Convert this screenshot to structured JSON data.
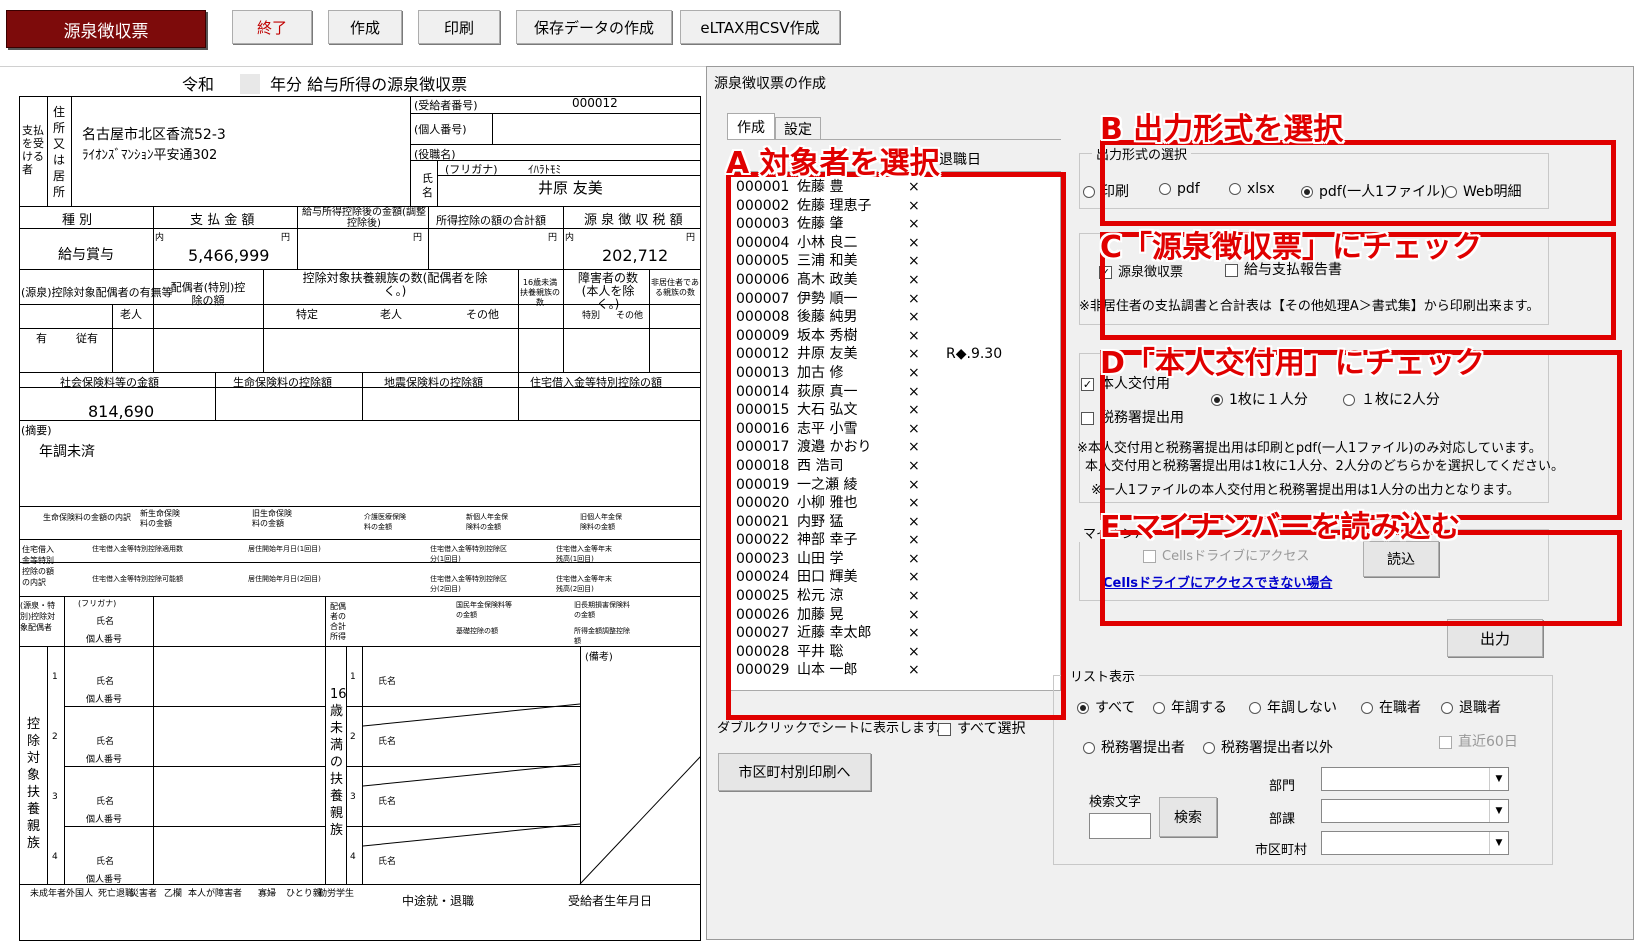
{
  "toolbar": {
    "brand": "源泉徴収票",
    "buttons": [
      "終了",
      "作成",
      "印刷",
      "保存データの作成",
      "eLTAX用CSV作成"
    ]
  },
  "form": {
    "title_prefix": "令和",
    "title_suffix": "年分 給与所得の源泉徴収票",
    "payee_label": "支払を受ける者",
    "address_label": "住所又は居所",
    "address_line1": "名古屋市北区香流52-3",
    "address_line2": "ﾗｲｵﾝｽﾞﾏﾝｼｮﾝ平安通302",
    "recipient_no_label": "(受給者番号)",
    "recipient_no": "000012",
    "personal_no_label": "(個人番号)",
    "position_label": "(役職名)",
    "name_label": "氏名",
    "furigana_label": "(フリガナ)",
    "furigana": "ｲﾊﾗﾄﾓﾐ",
    "name": "井原 友美",
    "col_type": "種 別",
    "col_payment": "支 払 金 額",
    "col_after_deduction": "給与所得控除後の金額(調整控除後)",
    "col_deduction_total": "所得控除の額の合計額",
    "col_withholding": "源 泉 徴 収 税 額",
    "row_type_value": "給与賞与",
    "payment_amount": "5,466,999",
    "withholding_amount": "202,712",
    "unit_yen": "円",
    "inner_label": "内",
    "spouse_label": "(源泉)控除対象配偶者の有無等",
    "elderly_label": "老人",
    "has_label": "有",
    "dependent_label": "従有",
    "spouse_deduction_label": "配偶者(特別)控除の額",
    "dependents_count_label": "控除対象扶養親族の数(配偶者を除く。)",
    "specific_label": "特定",
    "other_label": "その他",
    "under16_label": "16歳未満扶養親族の数",
    "disabled_label": "障害者の数(本人を除く。)",
    "special_label": "特別",
    "nonresident_label": "非居住者である親族の数",
    "person_unit": "人",
    "dependent_unit": "従人",
    "social_insurance_label": "社会保険料等の金額",
    "life_insurance_label": "生命保険料の控除額",
    "earthquake_label": "地震保険料の控除額",
    "housing_loan_label": "住宅借入金等特別控除の額",
    "social_insurance_amount": "814,690",
    "remarks_label": "(摘要)",
    "remarks_value": "年調未済",
    "life_detail_label": "生命保険料の金額の内訳",
    "new_life_label": "新生命保険料の金額",
    "old_life_label": "旧生命保険料の金額",
    "care_label": "介護医療保険料の金額",
    "new_pension_label": "新個人年金保険料の金額",
    "old_pension_label": "旧個人年金保険料の金額",
    "housing_detail_label": "住宅借入金等特別控除の額の内訳",
    "housing_count_label": "住宅借入金等特別控除適用数",
    "residence_date_label": "居住開始年月日(1回目)",
    "residence_date2_label": "居住開始年月日(2回目)",
    "housing_type_label": "住宅借入金等特別控除区分(1回目)",
    "housing_type2_label": "住宅借入金等特別控除区分(2回目)",
    "balance_label": "住宅借入金等年末残高(1回目)",
    "balance2_label": "住宅借入金等年末残高(2回目)",
    "possible_label": "住宅借入金等特別控除可能額",
    "spouse_section_label": "(源泉・特別)控除対象配偶者",
    "furigana_short": "(フリガナ)",
    "name_short": "氏名",
    "personal_no_short": "個人番号",
    "category_label": "区分",
    "spouse_income_label": "配偶者の合計所得",
    "national_pension_label": "国民年金保険料等の金額",
    "old_longterm_label": "旧長期損害保険料の金額",
    "basic_deduction_label": "基礎控除の額",
    "adjust_label": "所得金額調整控除額",
    "dependents_section_label": "控除対象扶養親族",
    "under16_section_label": "16歳未満の扶養親族",
    "remarks2_label": "(備考)",
    "nums": [
      "1",
      "2",
      "3",
      "4"
    ],
    "footer_labels": [
      "未成年者",
      "外国人",
      "死亡退職",
      "災害者",
      "乙欄",
      "本人が障害者",
      "寡婦",
      "ひとり親",
      "勤労学生"
    ],
    "footer_disabled_sub": [
      "特別",
      "その他"
    ],
    "footer_midway": "中途就・退職",
    "footer_birth": "受給者生年月日"
  },
  "dialog": {
    "title": "源泉徴収票の作成",
    "tabs": [
      "作成",
      "設定"
    ],
    "list_header_retire": "退職日",
    "employees": [
      {
        "code": "000001",
        "name": "佐藤 豊",
        "mark": "×",
        "retire": ""
      },
      {
        "code": "000002",
        "name": "佐藤 理恵子",
        "mark": "×",
        "retire": ""
      },
      {
        "code": "000003",
        "name": "佐藤 肇",
        "mark": "×",
        "retire": ""
      },
      {
        "code": "000004",
        "name": "小林 良二",
        "mark": "×",
        "retire": ""
      },
      {
        "code": "000005",
        "name": "三浦 和美",
        "mark": "×",
        "retire": ""
      },
      {
        "code": "000006",
        "name": "髙木 政美",
        "mark": "×",
        "retire": ""
      },
      {
        "code": "000007",
        "name": "伊勢 順一",
        "mark": "×",
        "retire": ""
      },
      {
        "code": "000008",
        "name": "後藤 純男",
        "mark": "×",
        "retire": ""
      },
      {
        "code": "000009",
        "name": "坂本 秀樹",
        "mark": "×",
        "retire": ""
      },
      {
        "code": "000012",
        "name": "井原 友美",
        "mark": "×",
        "retire": "R◆.9.30"
      },
      {
        "code": "000013",
        "name": "加古 修",
        "mark": "×",
        "retire": ""
      },
      {
        "code": "000014",
        "name": "荻原 真一",
        "mark": "×",
        "retire": ""
      },
      {
        "code": "000015",
        "name": "大石 弘文",
        "mark": "×",
        "retire": ""
      },
      {
        "code": "000016",
        "name": "志平 小雪",
        "mark": "×",
        "retire": ""
      },
      {
        "code": "000017",
        "name": "渡邉 かおり",
        "mark": "×",
        "retire": ""
      },
      {
        "code": "000018",
        "name": "西 浩司",
        "mark": "×",
        "retire": ""
      },
      {
        "code": "000019",
        "name": "一之瀬 綾",
        "mark": "×",
        "retire": ""
      },
      {
        "code": "000020",
        "name": "小柳 雅也",
        "mark": "×",
        "retire": ""
      },
      {
        "code": "000021",
        "name": "内野 猛",
        "mark": "×",
        "retire": ""
      },
      {
        "code": "000022",
        "name": "神部 幸子",
        "mark": "×",
        "retire": ""
      },
      {
        "code": "000023",
        "name": "山田 学",
        "mark": "×",
        "retire": ""
      },
      {
        "code": "000024",
        "name": "田口 輝美",
        "mark": "×",
        "retire": ""
      },
      {
        "code": "000025",
        "name": "松元 涼",
        "mark": "×",
        "retire": ""
      },
      {
        "code": "000026",
        "name": "加藤 晃",
        "mark": "×",
        "retire": ""
      },
      {
        "code": "000027",
        "name": "近藤 幸太郎",
        "mark": "×",
        "retire": ""
      },
      {
        "code": "000028",
        "name": "平井 聡",
        "mark": "×",
        "retire": ""
      },
      {
        "code": "000029",
        "name": "山本 一郎",
        "mark": "×",
        "retire": ""
      }
    ],
    "dblclick_hint": "ダブルクリックでシートに表示します。",
    "select_all": "すべて選択",
    "city_print_button": "市区町村別印刷へ",
    "output_format": {
      "label": "出力形式の選択",
      "options": [
        "印刷",
        "pdf",
        "xlsx",
        "pdf(一人1ファイル)",
        "Web明細"
      ],
      "selected": "pdf(一人1ファイル)"
    },
    "forms_group": {
      "label": "",
      "options": [
        {
          "label": "源泉徴収票",
          "checked": true
        },
        {
          "label": "給与支払報告書",
          "checked": false
        }
      ],
      "note": "※非居住者の支払調書と合計表は【その他処理A＞書式集】から印刷出来ます。"
    },
    "copy_group": {
      "options": [
        {
          "label": "本人交付用",
          "checked": true
        },
        {
          "label": "税務署提出用",
          "checked": false
        }
      ],
      "per_sheet": [
        "1枚に１人分",
        "１枚に2人分"
      ],
      "per_sheet_selected": "1枚に１人分",
      "note1": "※本人交付用と税務署提出用は印刷とpdf(一人1ファイル)のみ対応しています。",
      "note2": "本人交付用と税務署提出用は1枚に1人分、2人分のどちらかを選択してください。",
      "note3": "※一人1ファイルの本人交付用と税務署提出用は1人分の出力となります。"
    },
    "mynumber": {
      "label": "マイナンバー",
      "cells_checkbox": "Cellsドライブにアクセス",
      "link": "Cellsドライブにアクセスできない場合",
      "read_button": "読込"
    },
    "output_button": "出力",
    "list_display": {
      "label": "リスト表示",
      "options_row1": [
        "すべて",
        "年調する",
        "年調しない",
        "在職者",
        "退職者"
      ],
      "options_row2": [
        "税務署提出者",
        "税務署提出者以外"
      ],
      "selected": "すべて",
      "recent60": "直近60日",
      "search_label": "検索文字",
      "search_button": "検索",
      "filters": [
        "部門",
        "部課",
        "市区町村"
      ]
    },
    "annotations": {
      "A": "A 対象者を選択",
      "B": "B 出力形式を選択",
      "C": "C「源泉徴収票」にチェック",
      "D": "D「本人交付用」にチェック",
      "E": "E マイナンバーを読み込む"
    },
    "colors": {
      "annotation": "#e00000",
      "brand": "#7d0b0b"
    }
  }
}
